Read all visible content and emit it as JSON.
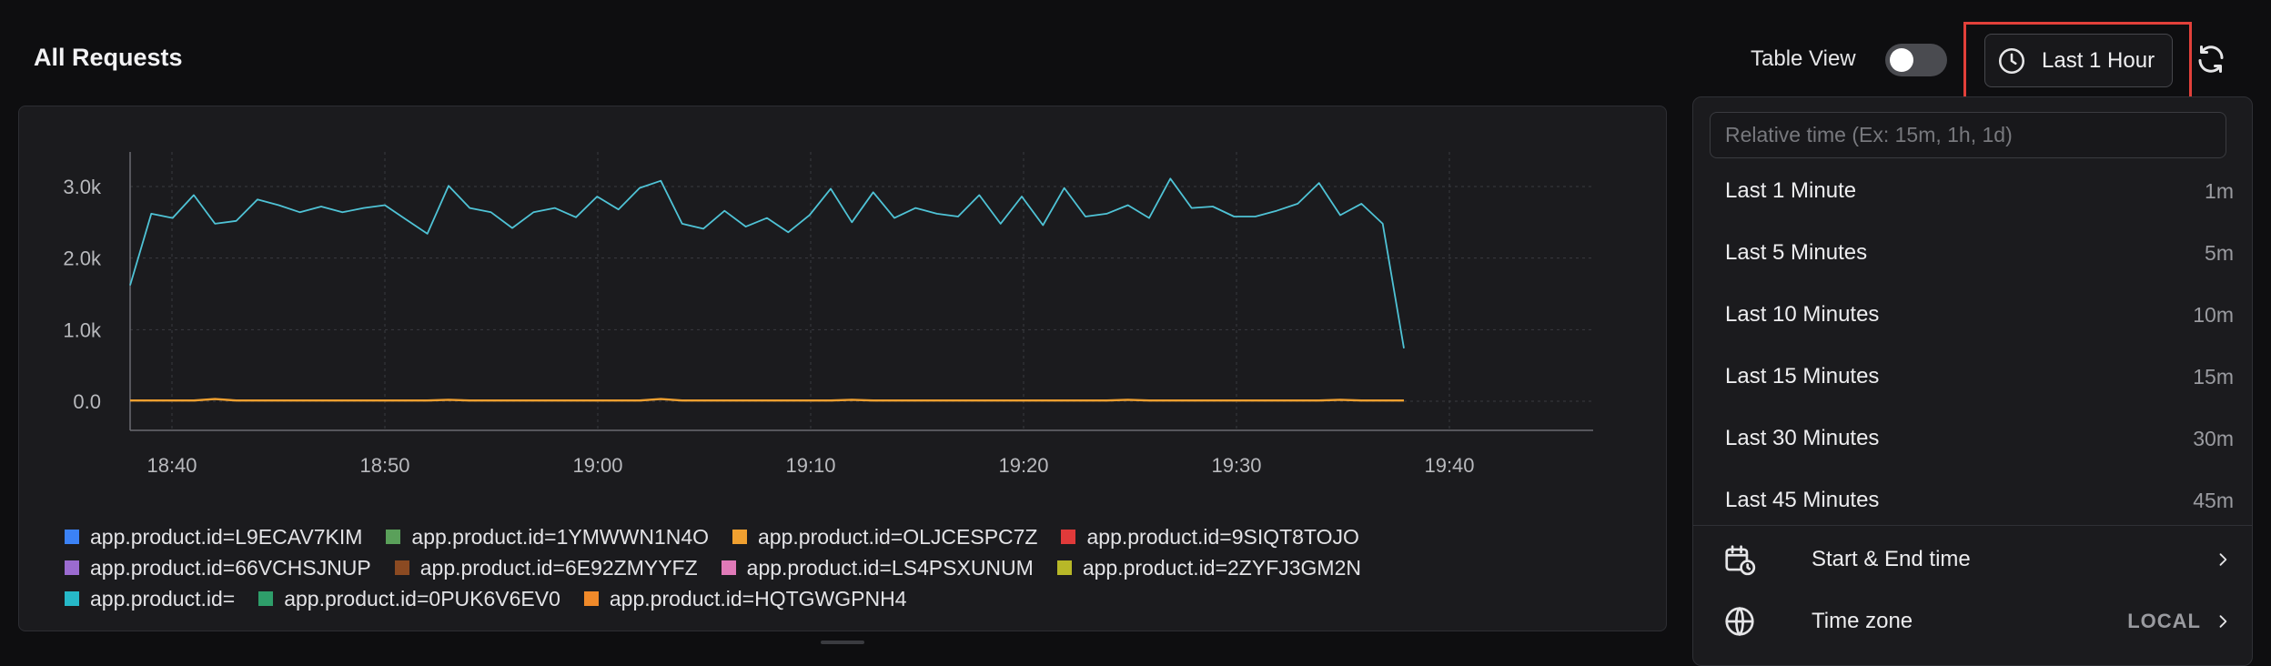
{
  "header": {
    "title": "All Requests",
    "table_view_label": "Table View",
    "table_view_on": false,
    "time_button_label": "Last 1 Hour",
    "refresh_icon": "refresh-icon",
    "clock_icon": "clock-icon"
  },
  "colors": {
    "accent_highlight": "#e2403a",
    "series_primary": "#4fc3d6",
    "series_secondary": "#f0a030"
  },
  "chart_data": {
    "type": "line",
    "yticks": [
      "3.0k",
      "2.0k",
      "1.0k",
      "0.0"
    ],
    "xticks": [
      "18:40",
      "18:50",
      "19:00",
      "19:10",
      "19:20",
      "19:30",
      "19:40"
    ],
    "ylim": [
      0,
      3000
    ],
    "grid": true,
    "legend_position": "bottom",
    "series": [
      {
        "name": "app.product.id=",
        "color": "#4fc3d6",
        "values": [
          1620,
          2620,
          2560,
          2880,
          2480,
          2520,
          2820,
          2740,
          2640,
          2720,
          2640,
          2700,
          2740,
          2540,
          2340,
          3010,
          2700,
          2640,
          2420,
          2640,
          2700,
          2570,
          2860,
          2680,
          2980,
          3080,
          2480,
          2410,
          2660,
          2440,
          2560,
          2360,
          2600,
          2970,
          2500,
          2920,
          2560,
          2700,
          2620,
          2580,
          2880,
          2480,
          2860,
          2460,
          2980,
          2580,
          2620,
          2740,
          2560,
          3110,
          2700,
          2720,
          2580,
          2580,
          2660,
          2760,
          3050,
          2600,
          2760,
          2480,
          740
        ]
      },
      {
        "name": "app.product.id=OLJCESPC7Z",
        "color": "#f0a030",
        "values": [
          10,
          10,
          10,
          10,
          30,
          10,
          10,
          10,
          10,
          10,
          10,
          10,
          10,
          10,
          10,
          20,
          10,
          10,
          10,
          10,
          10,
          10,
          10,
          10,
          10,
          30,
          10,
          10,
          10,
          10,
          10,
          10,
          10,
          10,
          20,
          10,
          10,
          10,
          10,
          10,
          10,
          10,
          10,
          10,
          10,
          10,
          10,
          20,
          10,
          10,
          10,
          10,
          10,
          10,
          10,
          10,
          10,
          20,
          10,
          10,
          10
        ]
      }
    ]
  },
  "legend": {
    "rows": [
      [
        {
          "label": "app.product.id=L9ECAV7KIM",
          "color": "#3b82f6"
        },
        {
          "label": "app.product.id=1YMWWN1N4O",
          "color": "#5aa05a"
        },
        {
          "label": "app.product.id=OLJCESPC7Z",
          "color": "#f0a030"
        },
        {
          "label": "app.product.id=9SIQT8TOJO",
          "color": "#e03a3a"
        }
      ],
      [
        {
          "label": "app.product.id=66VCHSJNUP",
          "color": "#9b6bd0"
        },
        {
          "label": "app.product.id=6E92ZMYYFZ",
          "color": "#8b4a22"
        },
        {
          "label": "app.product.id=LS4PSXUNUM",
          "color": "#e07ab8"
        },
        {
          "label": "app.product.id=2ZYFJ3GM2N",
          "color": "#b8b828"
        }
      ],
      [
        {
          "label": "app.product.id=",
          "color": "#26b8c8"
        },
        {
          "label": "app.product.id=0PUK6V6EV0",
          "color": "#2e9e6a"
        },
        {
          "label": "app.product.id=HQTGWGPNH4",
          "color": "#f08a2a"
        }
      ]
    ]
  },
  "dropdown": {
    "input_placeholder": "Relative time (Ex: 15m, 1h, 1d)",
    "input_value": "",
    "options": [
      {
        "label": "Last 1 Minute",
        "short": "1m"
      },
      {
        "label": "Last 5 Minutes",
        "short": "5m"
      },
      {
        "label": "Last 10 Minutes",
        "short": "10m"
      },
      {
        "label": "Last 15 Minutes",
        "short": "15m"
      },
      {
        "label": "Last 30 Minutes",
        "short": "30m"
      },
      {
        "label": "Last 45 Minutes",
        "short": "45m"
      }
    ],
    "start_end_label": "Start & End time",
    "timezone_label": "Time zone",
    "timezone_value": "LOCAL"
  }
}
